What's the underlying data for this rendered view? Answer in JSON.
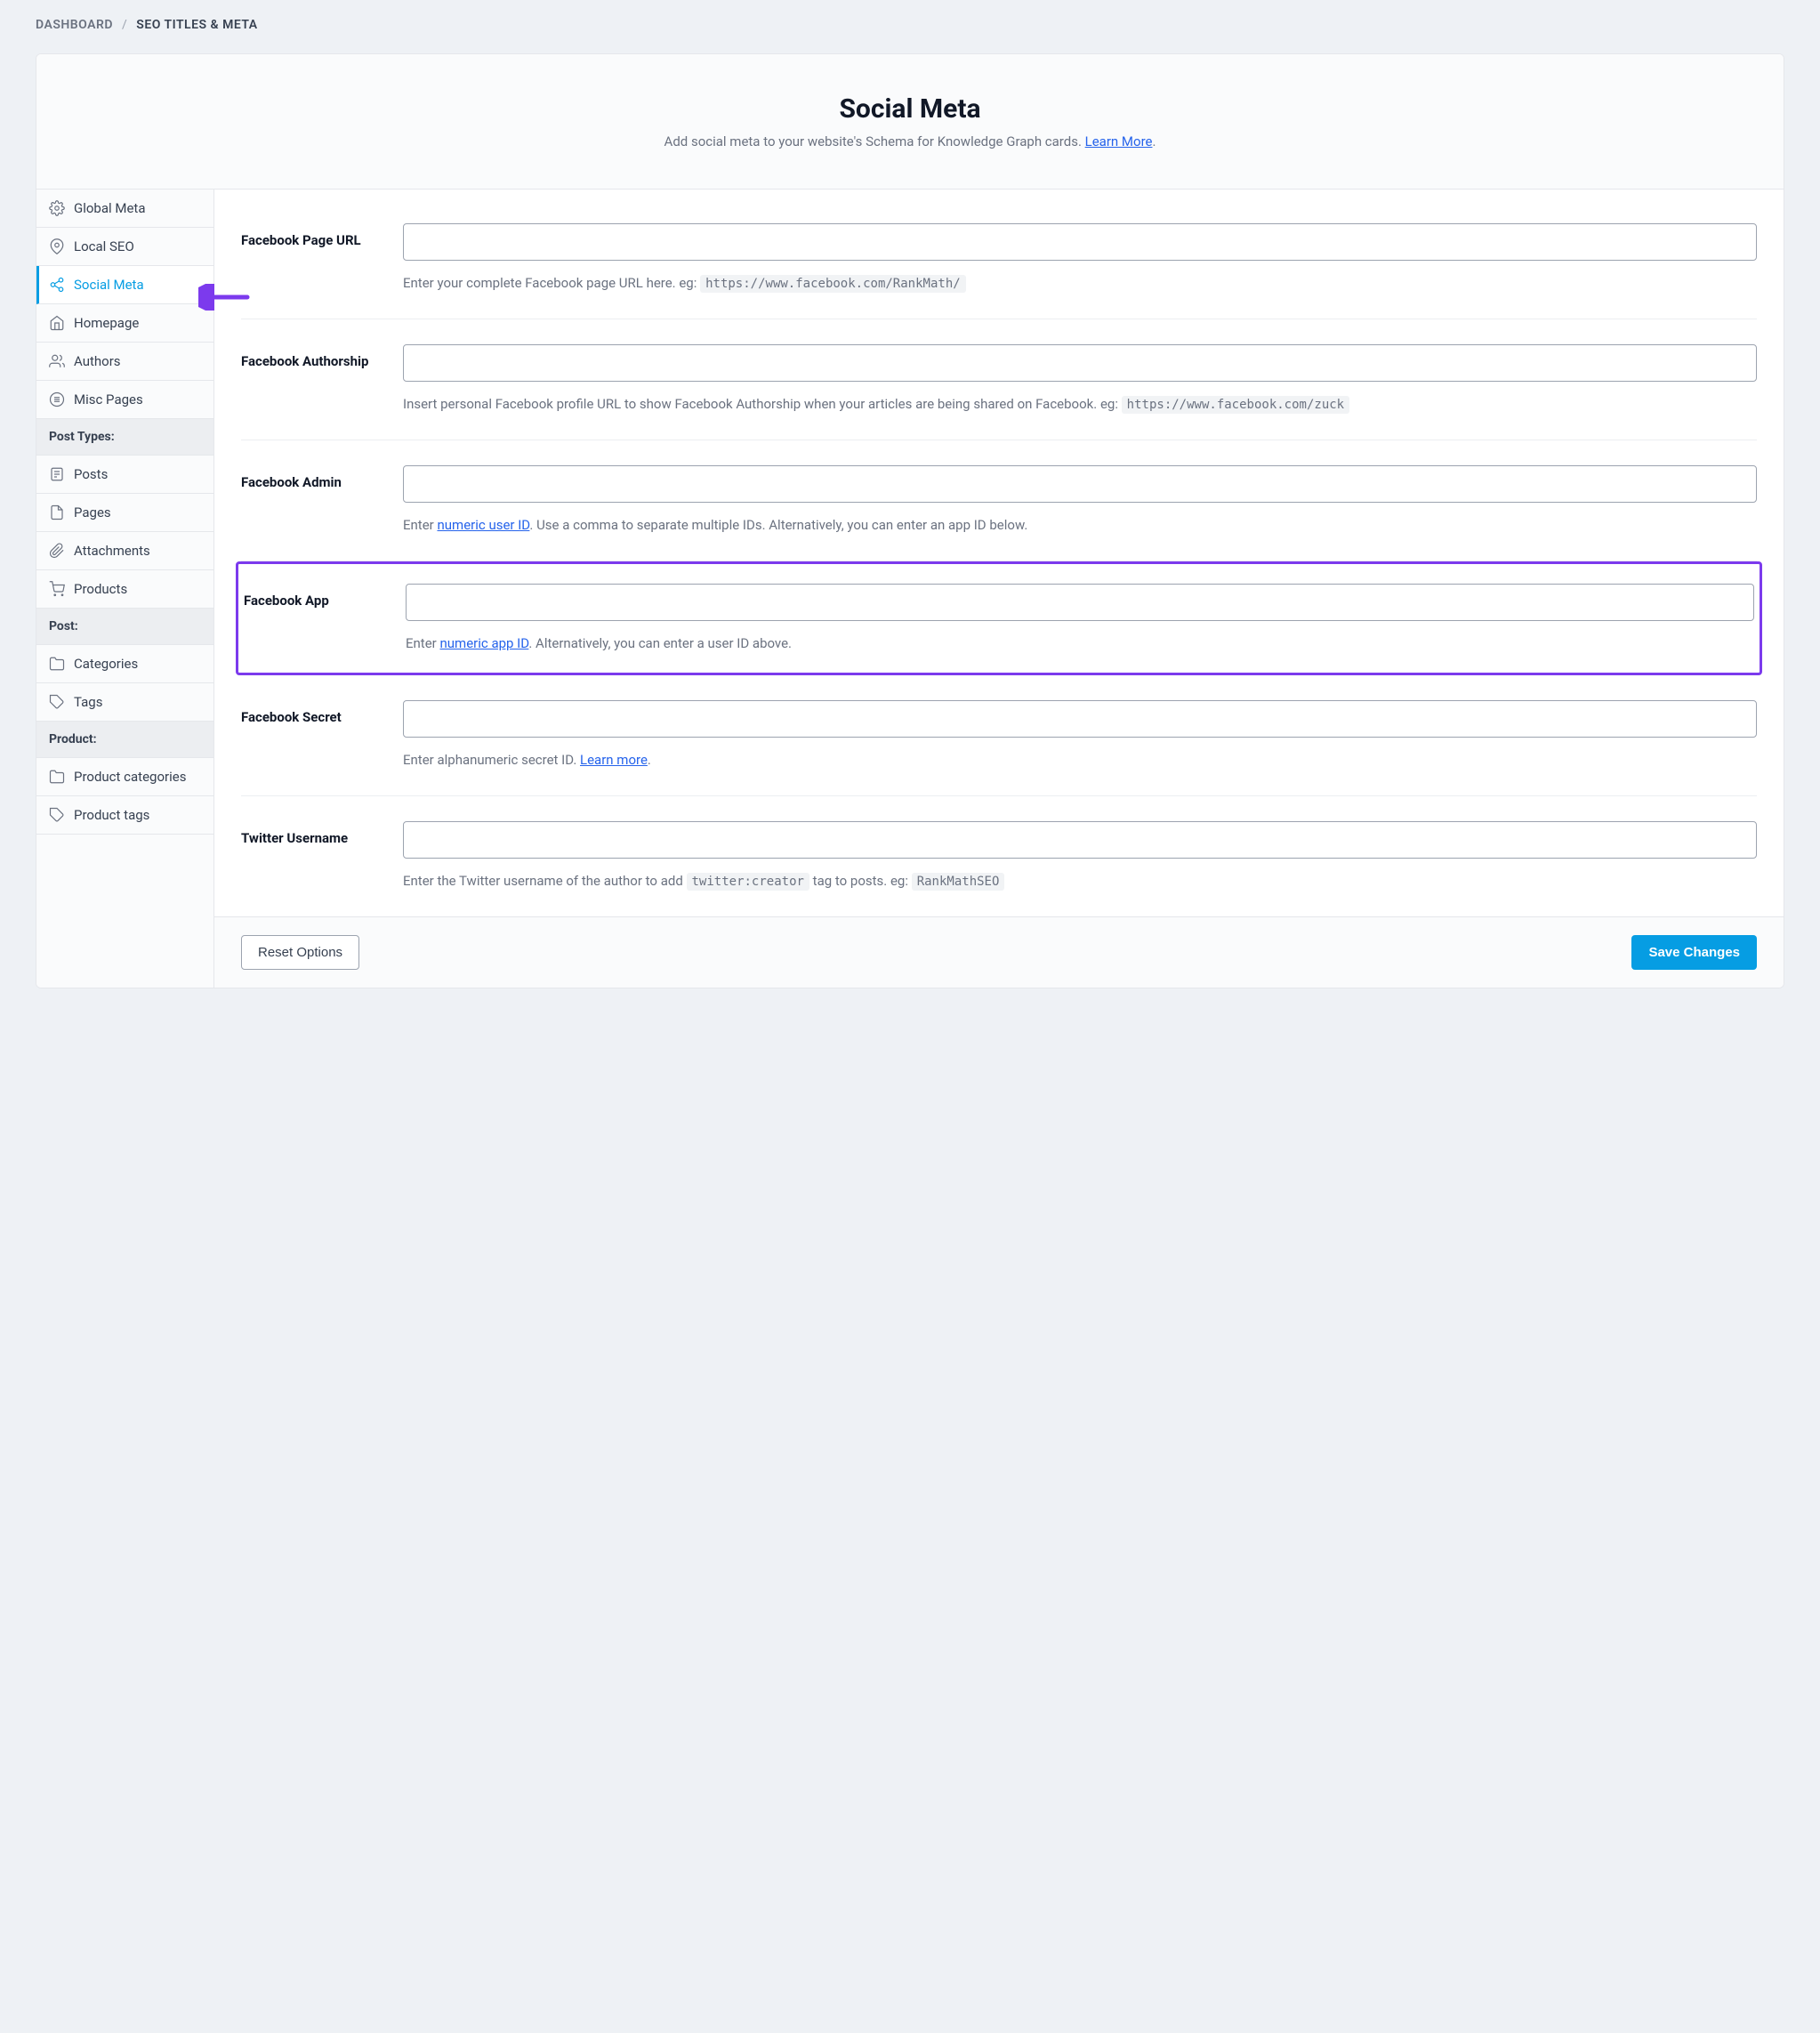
{
  "breadcrumb": {
    "root": "DASHBOARD",
    "sep": "/",
    "current": "SEO TITLES & META"
  },
  "header": {
    "title": "Social Meta",
    "desc_pre": "Add social meta to your website's Schema for Knowledge Graph cards. ",
    "learn_more": "Learn More",
    "desc_post": "."
  },
  "sidebar": {
    "items": [
      {
        "label": "Global Meta"
      },
      {
        "label": "Local SEO"
      },
      {
        "label": "Social Meta"
      },
      {
        "label": "Homepage"
      },
      {
        "label": "Authors"
      },
      {
        "label": "Misc Pages"
      }
    ],
    "heading_post_types": "Post Types:",
    "post_types": [
      {
        "label": "Posts"
      },
      {
        "label": "Pages"
      },
      {
        "label": "Attachments"
      },
      {
        "label": "Products"
      }
    ],
    "heading_post": "Post:",
    "post_tax": [
      {
        "label": "Categories"
      },
      {
        "label": "Tags"
      }
    ],
    "heading_product": "Product:",
    "product_tax": [
      {
        "label": "Product categories"
      },
      {
        "label": "Product tags"
      }
    ]
  },
  "fields": {
    "fb_page": {
      "label": "Facebook Page URL",
      "value": "",
      "help_pre": "Enter your complete Facebook page URL here. eg: ",
      "help_code": "https://www.facebook.com/RankMath/"
    },
    "fb_author": {
      "label": "Facebook Authorship",
      "value": "",
      "help_pre": "Insert personal Facebook profile URL to show Facebook Authorship when your articles are being shared on Facebook. eg: ",
      "help_code": "https://www.facebook.com/zuck"
    },
    "fb_admin": {
      "label": "Facebook Admin",
      "value": "",
      "help_pre": "Enter ",
      "help_link": "numeric user ID",
      "help_post": ". Use a comma to separate multiple IDs. Alternatively, you can enter an app ID below."
    },
    "fb_app": {
      "label": "Facebook App",
      "value": "",
      "help_pre": "Enter ",
      "help_link": "numeric app ID",
      "help_post": ". Alternatively, you can enter a user ID above."
    },
    "fb_secret": {
      "label": "Facebook Secret",
      "value": "",
      "help_pre": "Enter alphanumeric secret ID. ",
      "help_link": "Learn more",
      "help_post": "."
    },
    "twitter": {
      "label": "Twitter Username",
      "value": "",
      "help_pre": "Enter the Twitter username of the author to add ",
      "help_code1": "twitter:creator",
      "help_mid": " tag to posts. eg: ",
      "help_code2": "RankMathSEO"
    }
  },
  "footer": {
    "reset": "Reset Options",
    "save": "Save Changes"
  }
}
